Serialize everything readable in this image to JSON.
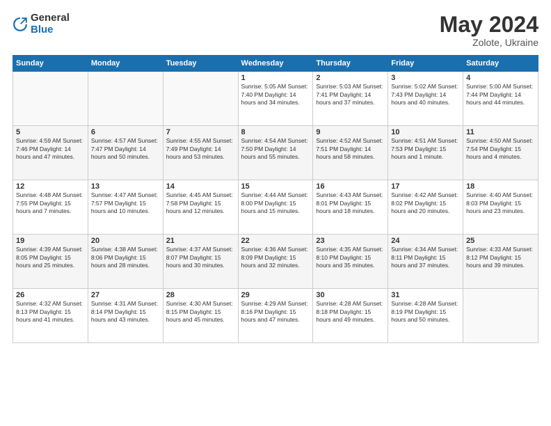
{
  "logo": {
    "general": "General",
    "blue": "Blue"
  },
  "title": {
    "month": "May 2024",
    "location": "Zolote, Ukraine"
  },
  "weekdays": [
    "Sunday",
    "Monday",
    "Tuesday",
    "Wednesday",
    "Thursday",
    "Friday",
    "Saturday"
  ],
  "weeks": [
    [
      {
        "day": "",
        "info": ""
      },
      {
        "day": "",
        "info": ""
      },
      {
        "day": "",
        "info": ""
      },
      {
        "day": "1",
        "info": "Sunrise: 5:05 AM\nSunset: 7:40 PM\nDaylight: 14 hours\nand 34 minutes."
      },
      {
        "day": "2",
        "info": "Sunrise: 5:03 AM\nSunset: 7:41 PM\nDaylight: 14 hours\nand 37 minutes."
      },
      {
        "day": "3",
        "info": "Sunrise: 5:02 AM\nSunset: 7:43 PM\nDaylight: 14 hours\nand 40 minutes."
      },
      {
        "day": "4",
        "info": "Sunrise: 5:00 AM\nSunset: 7:44 PM\nDaylight: 14 hours\nand 44 minutes."
      }
    ],
    [
      {
        "day": "5",
        "info": "Sunrise: 4:59 AM\nSunset: 7:46 PM\nDaylight: 14 hours\nand 47 minutes."
      },
      {
        "day": "6",
        "info": "Sunrise: 4:57 AM\nSunset: 7:47 PM\nDaylight: 14 hours\nand 50 minutes."
      },
      {
        "day": "7",
        "info": "Sunrise: 4:55 AM\nSunset: 7:49 PM\nDaylight: 14 hours\nand 53 minutes."
      },
      {
        "day": "8",
        "info": "Sunrise: 4:54 AM\nSunset: 7:50 PM\nDaylight: 14 hours\nand 55 minutes."
      },
      {
        "day": "9",
        "info": "Sunrise: 4:52 AM\nSunset: 7:51 PM\nDaylight: 14 hours\nand 58 minutes."
      },
      {
        "day": "10",
        "info": "Sunrise: 4:51 AM\nSunset: 7:53 PM\nDaylight: 15 hours\nand 1 minute."
      },
      {
        "day": "11",
        "info": "Sunrise: 4:50 AM\nSunset: 7:54 PM\nDaylight: 15 hours\nand 4 minutes."
      }
    ],
    [
      {
        "day": "12",
        "info": "Sunrise: 4:48 AM\nSunset: 7:55 PM\nDaylight: 15 hours\nand 7 minutes."
      },
      {
        "day": "13",
        "info": "Sunrise: 4:47 AM\nSunset: 7:57 PM\nDaylight: 15 hours\nand 10 minutes."
      },
      {
        "day": "14",
        "info": "Sunrise: 4:45 AM\nSunset: 7:58 PM\nDaylight: 15 hours\nand 12 minutes."
      },
      {
        "day": "15",
        "info": "Sunrise: 4:44 AM\nSunset: 8:00 PM\nDaylight: 15 hours\nand 15 minutes."
      },
      {
        "day": "16",
        "info": "Sunrise: 4:43 AM\nSunset: 8:01 PM\nDaylight: 15 hours\nand 18 minutes."
      },
      {
        "day": "17",
        "info": "Sunrise: 4:42 AM\nSunset: 8:02 PM\nDaylight: 15 hours\nand 20 minutes."
      },
      {
        "day": "18",
        "info": "Sunrise: 4:40 AM\nSunset: 8:03 PM\nDaylight: 15 hours\nand 23 minutes."
      }
    ],
    [
      {
        "day": "19",
        "info": "Sunrise: 4:39 AM\nSunset: 8:05 PM\nDaylight: 15 hours\nand 25 minutes."
      },
      {
        "day": "20",
        "info": "Sunrise: 4:38 AM\nSunset: 8:06 PM\nDaylight: 15 hours\nand 28 minutes."
      },
      {
        "day": "21",
        "info": "Sunrise: 4:37 AM\nSunset: 8:07 PM\nDaylight: 15 hours\nand 30 minutes."
      },
      {
        "day": "22",
        "info": "Sunrise: 4:36 AM\nSunset: 8:09 PM\nDaylight: 15 hours\nand 32 minutes."
      },
      {
        "day": "23",
        "info": "Sunrise: 4:35 AM\nSunset: 8:10 PM\nDaylight: 15 hours\nand 35 minutes."
      },
      {
        "day": "24",
        "info": "Sunrise: 4:34 AM\nSunset: 8:11 PM\nDaylight: 15 hours\nand 37 minutes."
      },
      {
        "day": "25",
        "info": "Sunrise: 4:33 AM\nSunset: 8:12 PM\nDaylight: 15 hours\nand 39 minutes."
      }
    ],
    [
      {
        "day": "26",
        "info": "Sunrise: 4:32 AM\nSunset: 8:13 PM\nDaylight: 15 hours\nand 41 minutes."
      },
      {
        "day": "27",
        "info": "Sunrise: 4:31 AM\nSunset: 8:14 PM\nDaylight: 15 hours\nand 43 minutes."
      },
      {
        "day": "28",
        "info": "Sunrise: 4:30 AM\nSunset: 8:15 PM\nDaylight: 15 hours\nand 45 minutes."
      },
      {
        "day": "29",
        "info": "Sunrise: 4:29 AM\nSunset: 8:16 PM\nDaylight: 15 hours\nand 47 minutes."
      },
      {
        "day": "30",
        "info": "Sunrise: 4:28 AM\nSunset: 8:18 PM\nDaylight: 15 hours\nand 49 minutes."
      },
      {
        "day": "31",
        "info": "Sunrise: 4:28 AM\nSunset: 8:19 PM\nDaylight: 15 hours\nand 50 minutes."
      },
      {
        "day": "",
        "info": ""
      }
    ]
  ]
}
